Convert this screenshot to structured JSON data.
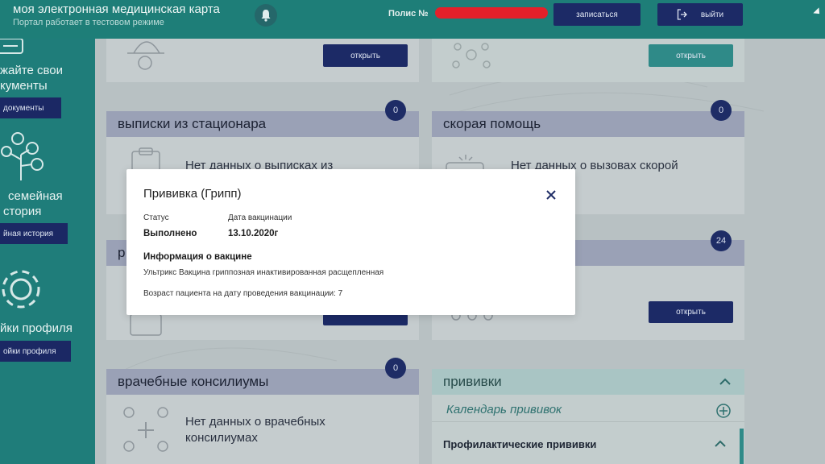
{
  "header": {
    "title": "моя электронная медицинская карта",
    "subtitle": "Портал работает в тестовом режиме",
    "policy_label": "Полис №",
    "appointment_button": "записаться",
    "logout_button": "выйти"
  },
  "sidebar": {
    "documents_text_1": "жайте свои",
    "documents_text_2": "кументы",
    "documents_button": "документы",
    "family_text_1": "семейная",
    "family_text_2": "стория",
    "family_button": "йная история",
    "profile_text": "йки профиля",
    "profile_button": "ойки профиля"
  },
  "cards": {
    "top_left_button": "открыть",
    "top_right_button": "открыть",
    "discharge": {
      "title": "выписки из стационара",
      "count": "0",
      "empty_text": "Нет данных о выписках из"
    },
    "ambulance": {
      "title": "скорая помощь",
      "count": "0",
      "empty_text": "Нет данных о вызовах скорой"
    },
    "middle_left_title_fragment": "р",
    "middle_right": {
      "count": "24",
      "button": "открыть"
    },
    "consilium": {
      "title": "врачебные консилиумы",
      "count": "0",
      "empty_text_1": "Нет данных о врачебных",
      "empty_text_2": "консилиумах"
    },
    "vaccinations": {
      "title": "прививки",
      "calendar": "Календарь прививок",
      "preventive": "Профилактические прививки"
    }
  },
  "modal": {
    "title": "Прививка (Грипп)",
    "status_label": "Статус",
    "status_value": "Выполнено",
    "date_label": "Дата вакцинации",
    "date_value": "13.10.2020г",
    "vaccine_info_title": "Информация о вакцине",
    "vaccine_name": "Ультрикс Вакцина гриппозная инактивированная расщепленная",
    "patient_age": "Возраст пациента на дату проведения вакцинации: 7"
  },
  "colors": {
    "topbar": "#1e7e78",
    "accent_dark": "#1c2a66",
    "card_head": "#9aa1b6",
    "vaccination_head": "#a9c5c4"
  }
}
